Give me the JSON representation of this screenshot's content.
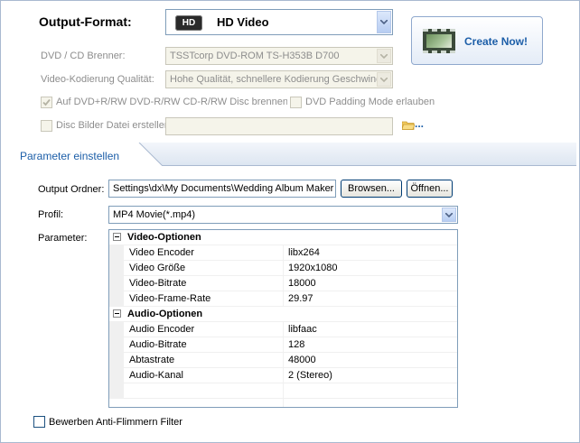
{
  "header": {
    "output_format_label": "Output-Format:",
    "output_format_badge": "HD",
    "output_format_value": "HD Video",
    "create_button_label": "Create Now!"
  },
  "dvd_burner": {
    "label": "DVD / CD Brenner:",
    "value": "TSSTcorp DVD-ROM TS-H353B D700"
  },
  "video_quality": {
    "label": "Video-Kodierung Qualität:",
    "value": "Hohe Qualität, schnellere Kodierung Geschwindi"
  },
  "checkboxes": {
    "dvd_rw_label": "Auf DVD+R/RW DVD-R/RW CD-R/RW Disc brennen",
    "dvd_rw_checked": true,
    "dvd_padding_label": "DVD Padding Mode erlauben",
    "dvd_padding_checked": false,
    "disc_image_label": "Disc Bilder Datei ersteller",
    "disc_image_checked": false,
    "disc_image_path": "",
    "browse_dots": "..."
  },
  "section": {
    "title": "Parameter einstellen"
  },
  "output_folder": {
    "label": "Output Ordner:",
    "value": "Settings\\dx\\My Documents\\Wedding Album Maker",
    "browse_label": "Browsen...",
    "open_label": "Öffnen..."
  },
  "profile": {
    "label": "Profil:",
    "value": "MP4 Movie(*.mp4)"
  },
  "parameters": {
    "label": "Parameter:",
    "video": {
      "category": "Video-Optionen",
      "rows": [
        {
          "name": "Video Encoder",
          "value": "libx264"
        },
        {
          "name": "Video Größe",
          "value": "1920x1080"
        },
        {
          "name": "Video-Bitrate",
          "value": "18000"
        },
        {
          "name": "Video-Frame-Rate",
          "value": "29.97"
        }
      ]
    },
    "audio": {
      "category": "Audio-Optionen",
      "rows": [
        {
          "name": "Audio Encoder",
          "value": "libfaac"
        },
        {
          "name": "Audio-Bitrate",
          "value": "128"
        },
        {
          "name": "Abtastrate",
          "value": "48000"
        },
        {
          "name": "Audio-Kanal",
          "value": "2 (Stereo)"
        }
      ]
    }
  },
  "anti_flicker": {
    "label": "Bewerben Anti-Flimmern Filter",
    "checked": false
  },
  "colors": {
    "accent_blue": "#1c5ea8",
    "border_blue": "#7f9db9",
    "disabled_text": "#8d8d8d"
  }
}
